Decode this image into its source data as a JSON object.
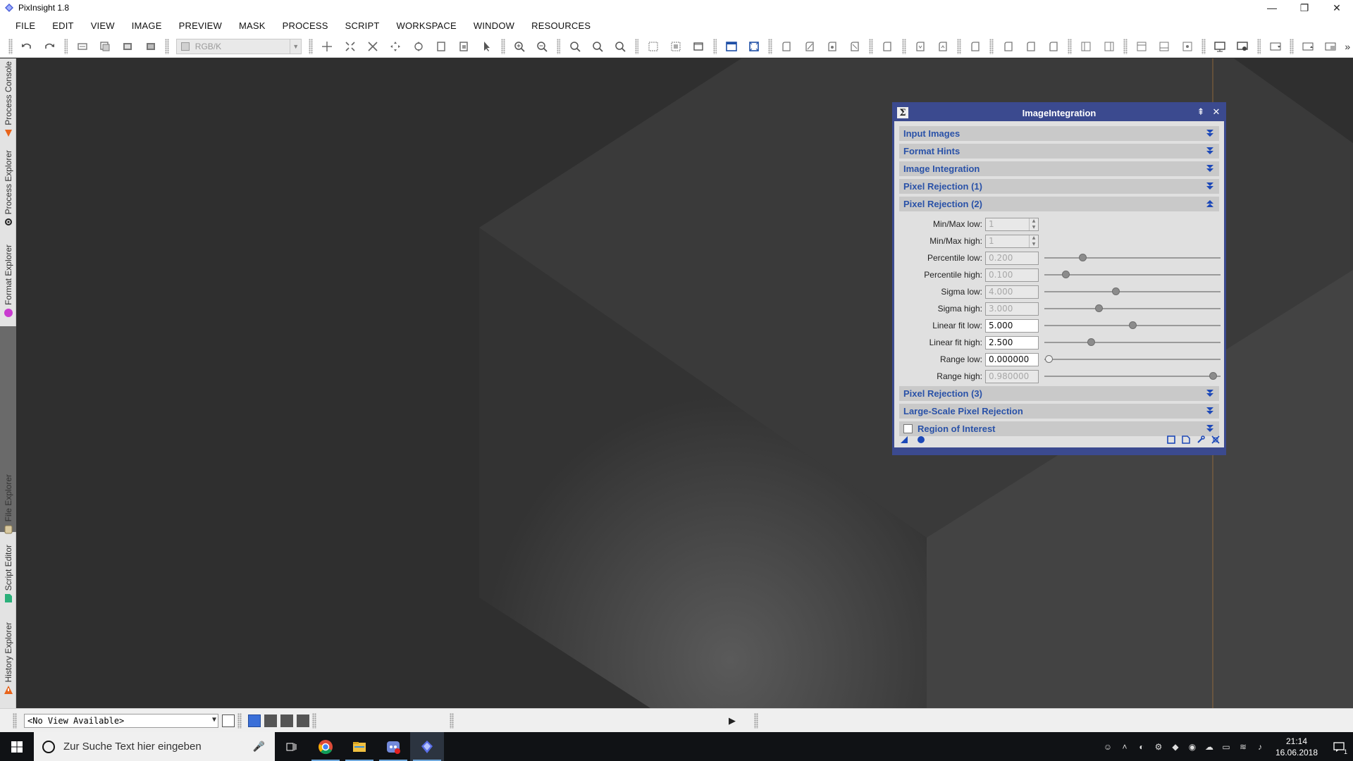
{
  "window": {
    "title": "PixInsight 1.8",
    "minimize": "—",
    "restore": "❐",
    "close": "✕"
  },
  "menu": [
    "FILE",
    "EDIT",
    "VIEW",
    "IMAGE",
    "PREVIEW",
    "MASK",
    "PROCESS",
    "SCRIPT",
    "WORKSPACE",
    "WINDOW",
    "RESOURCES"
  ],
  "toolbar": {
    "color_space": "RGB/K",
    "overflow": "»"
  },
  "sidedock": {
    "tabs": [
      "Process Console",
      "Process Explorer",
      "Format Explorer",
      "File Explorer",
      "Script Editor",
      "History Explorer"
    ]
  },
  "process_window": {
    "title": "ImageIntegration",
    "sections_top": [
      "Input Images",
      "Format Hints",
      "Image Integration",
      "Pixel Rejection (1)"
    ],
    "expanded_section": "Pixel Rejection (2)",
    "params": [
      {
        "label": "Min/Max low:",
        "value": "1",
        "type": "spin",
        "enabled": false,
        "slider": null
      },
      {
        "label": "Min/Max high:",
        "value": "1",
        "type": "spin",
        "enabled": false,
        "slider": null
      },
      {
        "label": "Percentile low:",
        "value": "0.200",
        "type": "input",
        "enabled": false,
        "slider": 0.2
      },
      {
        "label": "Percentile high:",
        "value": "0.100",
        "type": "input",
        "enabled": false,
        "slider": 0.1
      },
      {
        "label": "Sigma low:",
        "value": "4.000",
        "type": "input",
        "enabled": false,
        "slider": 0.4
      },
      {
        "label": "Sigma high:",
        "value": "3.000",
        "type": "input",
        "enabled": false,
        "slider": 0.3
      },
      {
        "label": "Linear fit low:",
        "value": "5.000",
        "type": "input",
        "enabled": true,
        "slider": 0.5
      },
      {
        "label": "Linear fit high:",
        "value": "2.500",
        "type": "input",
        "enabled": true,
        "slider": 0.25
      },
      {
        "label": "Range low:",
        "value": "0.000000",
        "type": "input",
        "enabled": true,
        "slider": 0.0
      },
      {
        "label": "Range high:",
        "value": "0.980000",
        "type": "input",
        "enabled": false,
        "slider": 0.98
      }
    ],
    "sections_bottom": [
      "Pixel Rejection (3)",
      "Large-Scale Pixel Rejection"
    ],
    "roi_section": "Region of Interest"
  },
  "statusbar": {
    "view_selector": "<No View Available>"
  },
  "taskbar": {
    "search_placeholder": "Zur Suche Text hier eingeben",
    "time": "21:14",
    "date": "16.06.2018",
    "notification_count": "1"
  },
  "colors": {
    "accent": "#3b4a8f",
    "section_text": "#2a52a8",
    "workspace": "#2f2f2f"
  }
}
